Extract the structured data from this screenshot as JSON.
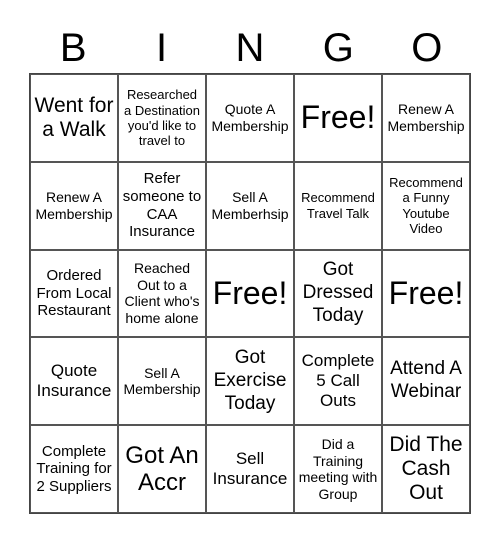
{
  "header": {
    "letters": [
      "B",
      "I",
      "N",
      "G",
      "O"
    ]
  },
  "card": {
    "rows": [
      [
        "Went for a Walk",
        "Researched a Destination you'd like to travel to",
        "Quote A Membership",
        "Free!",
        "Renew A Membership"
      ],
      [
        "Renew A Membership",
        "Refer someone to CAA Insurance",
        "Sell A Memberhsip",
        "Recommend Travel Talk",
        "Recommend a Funny Youtube Video"
      ],
      [
        "Ordered From Local Restaurant",
        "Reached Out to a Client who's home alone",
        "Free!",
        "Got Dressed Today",
        "Free!"
      ],
      [
        "Quote Insurance",
        "Sell A Membership",
        "Got Exercise Today",
        "Complete 5 Call Outs",
        "Attend A Webinar"
      ],
      [
        "Complete Training for 2 Suppliers",
        "Got An Accr",
        "Sell Insurance",
        "Did a Training meeting with Group",
        "Did The Cash Out"
      ]
    ]
  }
}
